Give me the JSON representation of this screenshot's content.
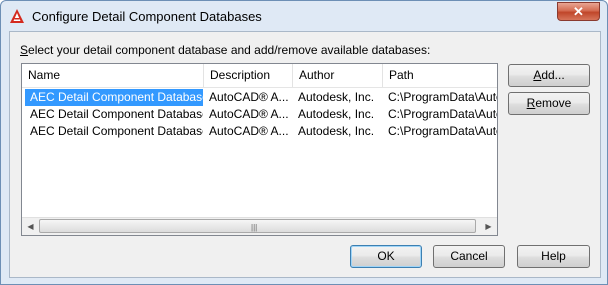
{
  "window": {
    "title": "Configure Detail Component Databases",
    "close_glyph": "✕"
  },
  "instruction": {
    "prefix": "S",
    "rest": "elect your detail component database and add/remove available databases:"
  },
  "columns": [
    "Name",
    "Description",
    "Author",
    "Path"
  ],
  "rows": [
    {
      "name": "AEC Detail Component Database ...",
      "description": "AutoCAD® A...",
      "author": "Autodesk, Inc.",
      "path": "C:\\ProgramData\\Autode"
    },
    {
      "name": "AEC Detail Component Database ...",
      "description": "AutoCAD® A...",
      "author": "Autodesk, Inc.",
      "path": "C:\\ProgramData\\Autode"
    },
    {
      "name": "AEC Detail Component Database ...",
      "description": "AutoCAD® A...",
      "author": "Autodesk, Inc.",
      "path": "C:\\ProgramData\\Autode"
    }
  ],
  "selected_row": 0,
  "scrollbar": {
    "left_glyph": "◀",
    "right_glyph": "▶",
    "grip": "|||"
  },
  "buttons": {
    "add": {
      "mnemonic": "A",
      "rest": "dd..."
    },
    "remove": {
      "mnemonic": "R",
      "rest": "emove"
    },
    "ok": "OK",
    "cancel": "Cancel",
    "help": "Help"
  },
  "colors": {
    "selection": "#3399ff",
    "titlebar": "#dfe9f5",
    "close": "#c7462b"
  }
}
